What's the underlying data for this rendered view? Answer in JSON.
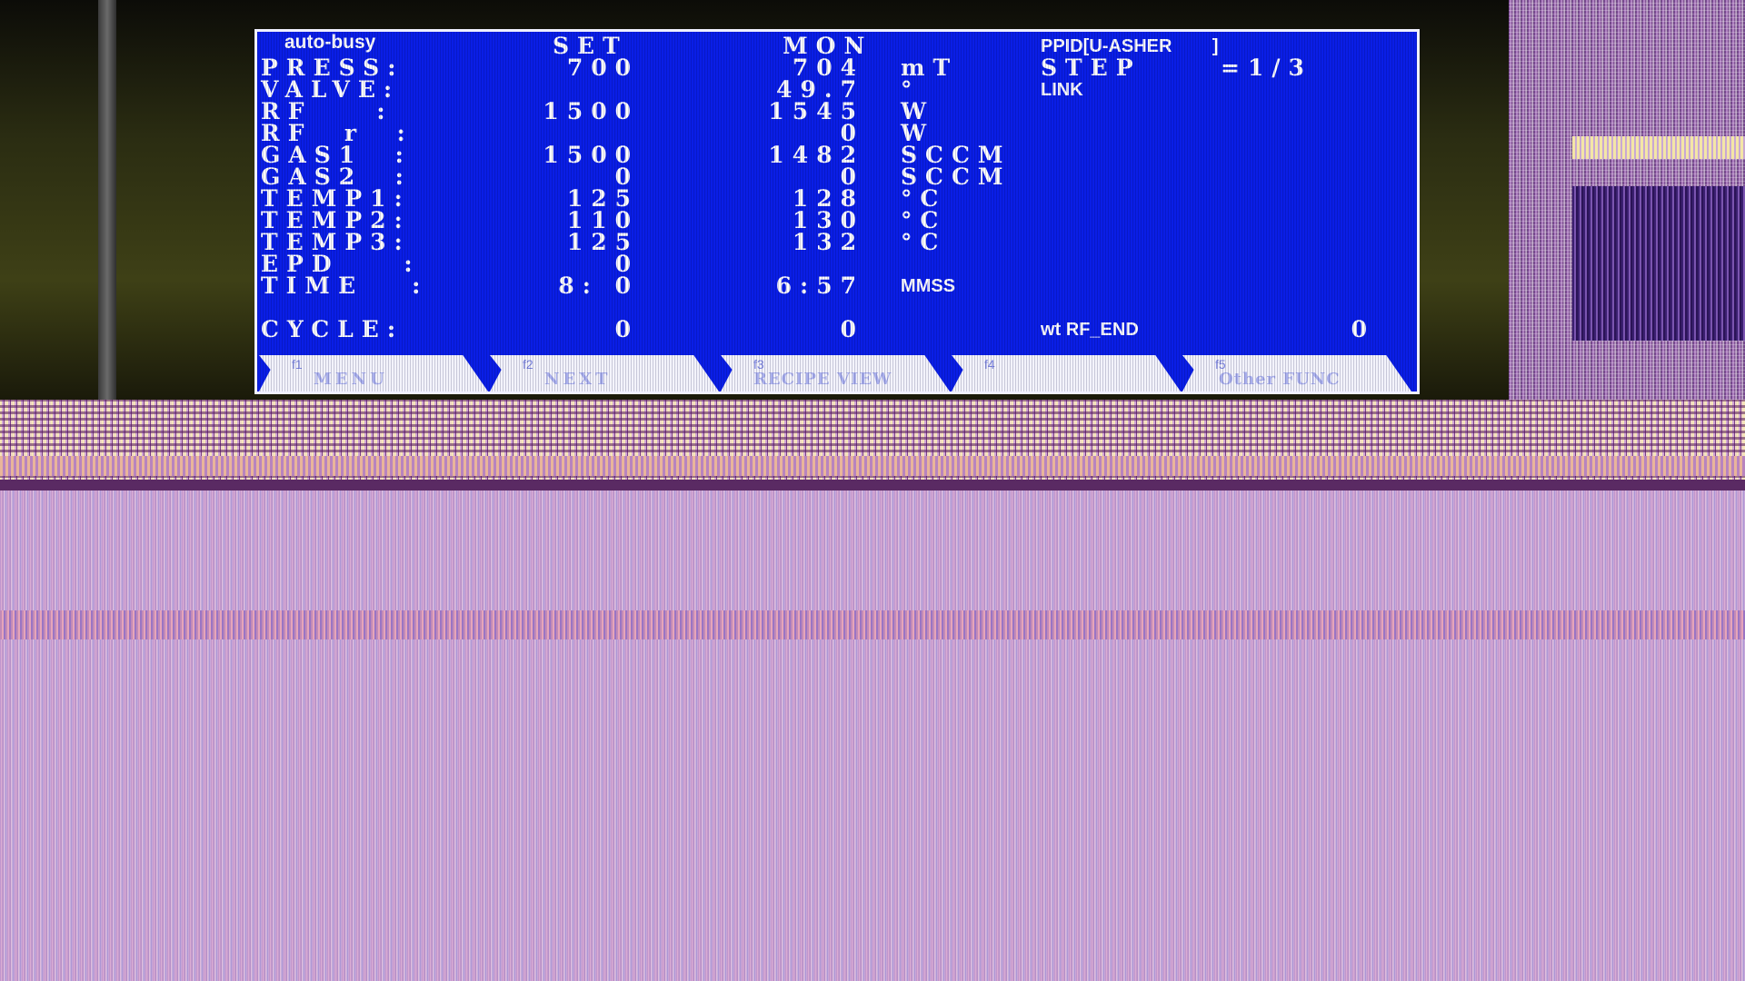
{
  "screen": {
    "status": "auto-busy",
    "header_set": "SET",
    "header_mon": "MON",
    "ppid_label": "PPID[U-ASHER        ]",
    "step_label": "STEP",
    "step_value": "=1/3",
    "link_label": "LINK",
    "rows": [
      {
        "label": "PRESS:",
        "set": "700",
        "mon": "704",
        "unit": "mT"
      },
      {
        "label": "VALVE:",
        "set": "",
        "mon": "49.7",
        "unit": "°"
      },
      {
        "label": "RF    :",
        "set": "1500",
        "mon": "1545",
        "unit": "W"
      },
      {
        "label": "RF  r  :",
        "set": "",
        "mon": "0",
        "unit": "W"
      },
      {
        "label": "GAS1  :",
        "set": "1500",
        "mon": "1482",
        "unit": "SCCM"
      },
      {
        "label": "GAS2  :",
        "set": "0",
        "mon": "0",
        "unit": "SCCM"
      },
      {
        "label": "TEMP1:",
        "set": "125",
        "mon": "128",
        "unit": "°C"
      },
      {
        "label": "TEMP2:",
        "set": "110",
        "mon": "130",
        "unit": "°C"
      },
      {
        "label": "TEMP3:",
        "set": "125",
        "mon": "132",
        "unit": "°C"
      },
      {
        "label": "EPD    :",
        "set": "0",
        "mon": "",
        "unit": ""
      },
      {
        "label": "TIME   :",
        "set": "8: 0",
        "mon": "6:57",
        "unit": "MMSS"
      }
    ],
    "cycle": {
      "label": "CYCLE:",
      "set": "0",
      "mon": "0",
      "wt_label": "wt RF_END",
      "wt_value": "0"
    }
  },
  "fkeys": [
    {
      "num": "f1",
      "label": "MENU"
    },
    {
      "num": "f2",
      "label": "NEXT"
    },
    {
      "num": "f3",
      "label": "RECIPE VIEW"
    },
    {
      "num": "f4",
      "label": ""
    },
    {
      "num": "f5",
      "label": "Other FUNC"
    }
  ]
}
